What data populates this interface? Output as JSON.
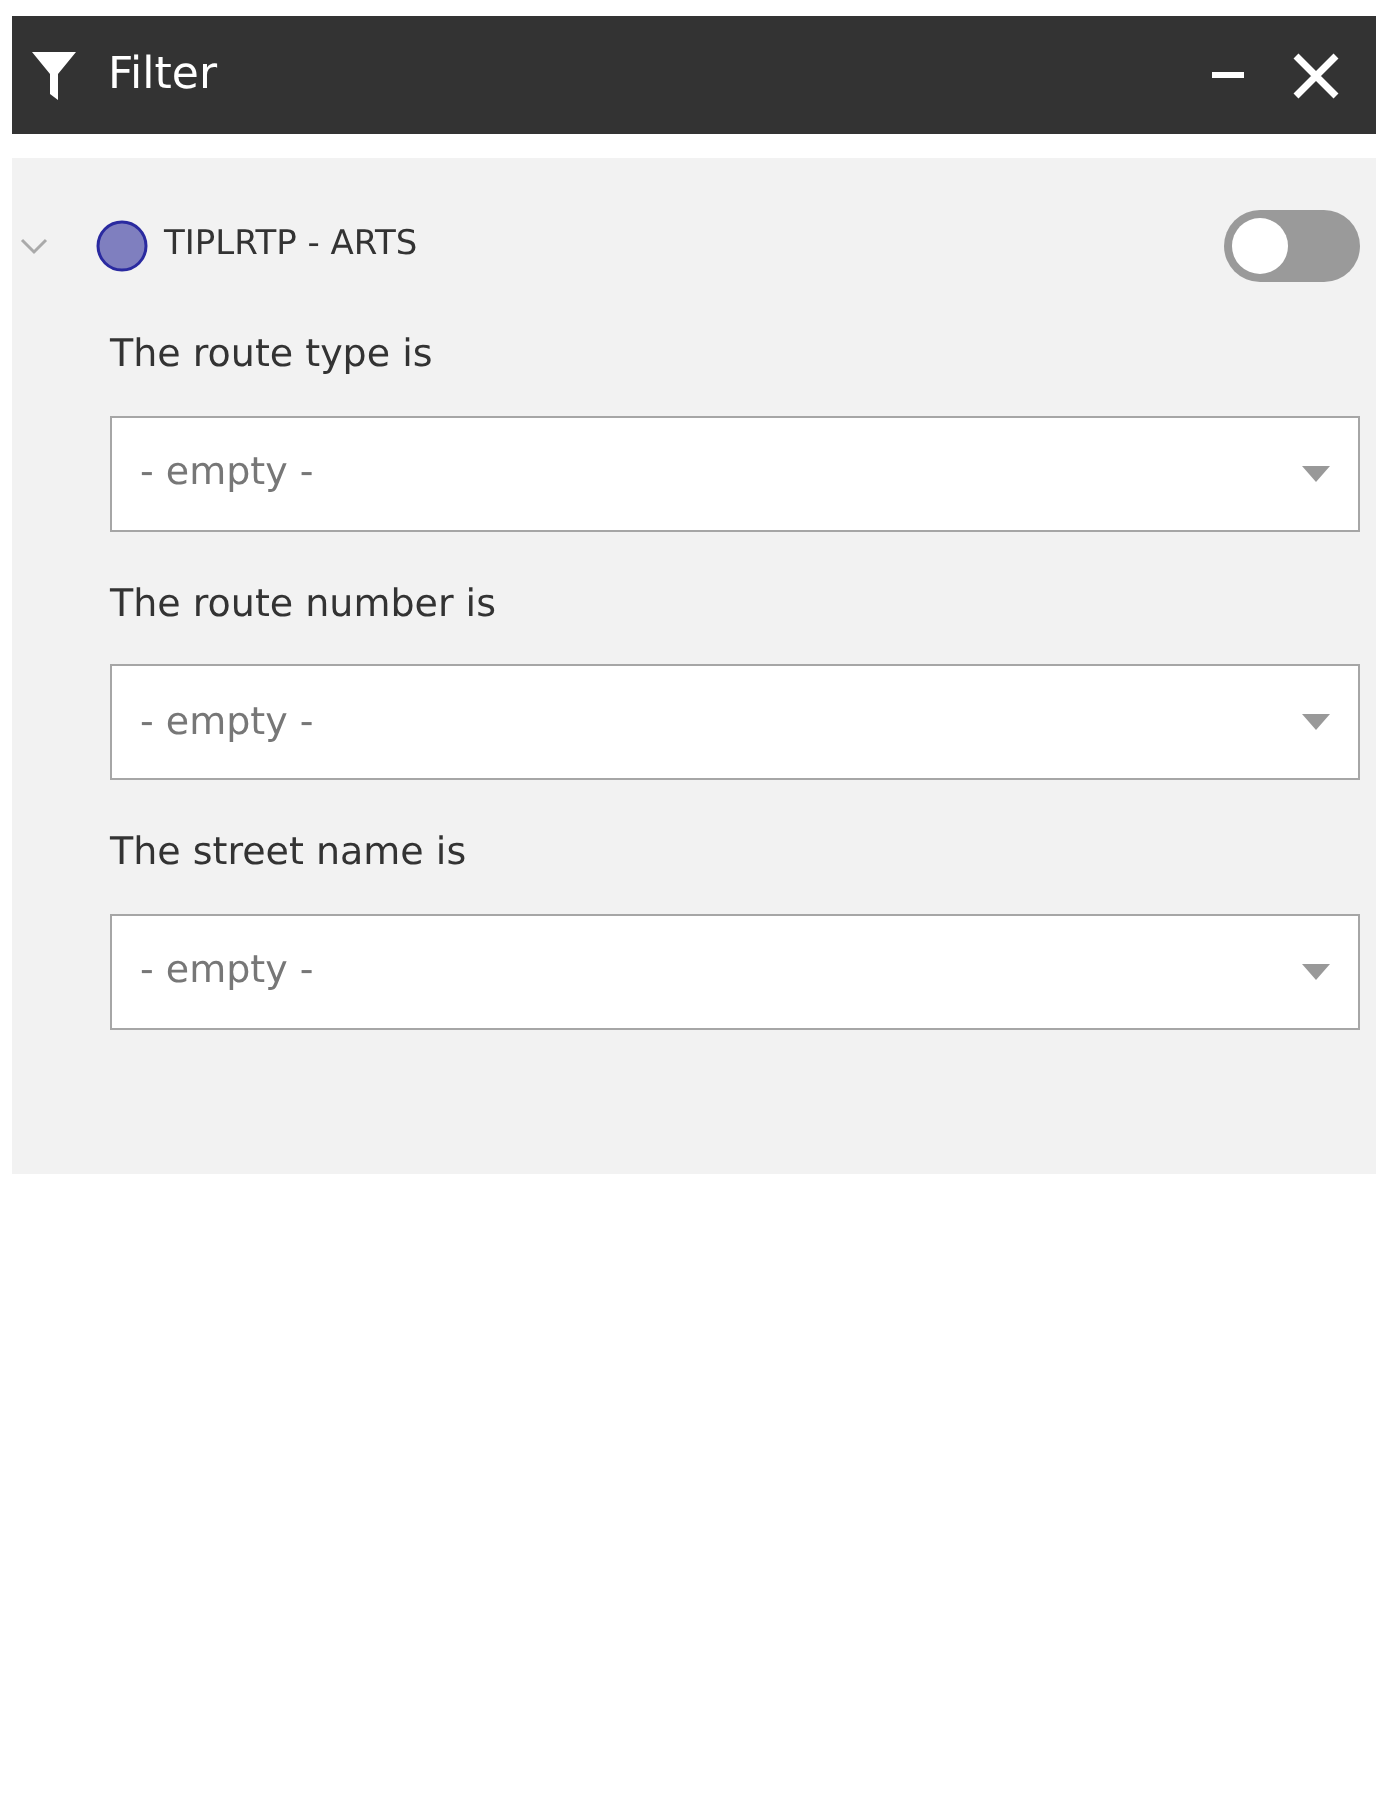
{
  "window": {
    "title": "Filter"
  },
  "layer": {
    "name": "TIPLRTP - ARTS",
    "color": "#7f7fbf",
    "expanded": true,
    "on": false
  },
  "filters": [
    {
      "label": "The route type is",
      "value": "- empty -"
    },
    {
      "label": "The route number is",
      "value": "- empty -"
    },
    {
      "label": "The street name is",
      "value": "- empty -"
    }
  ]
}
